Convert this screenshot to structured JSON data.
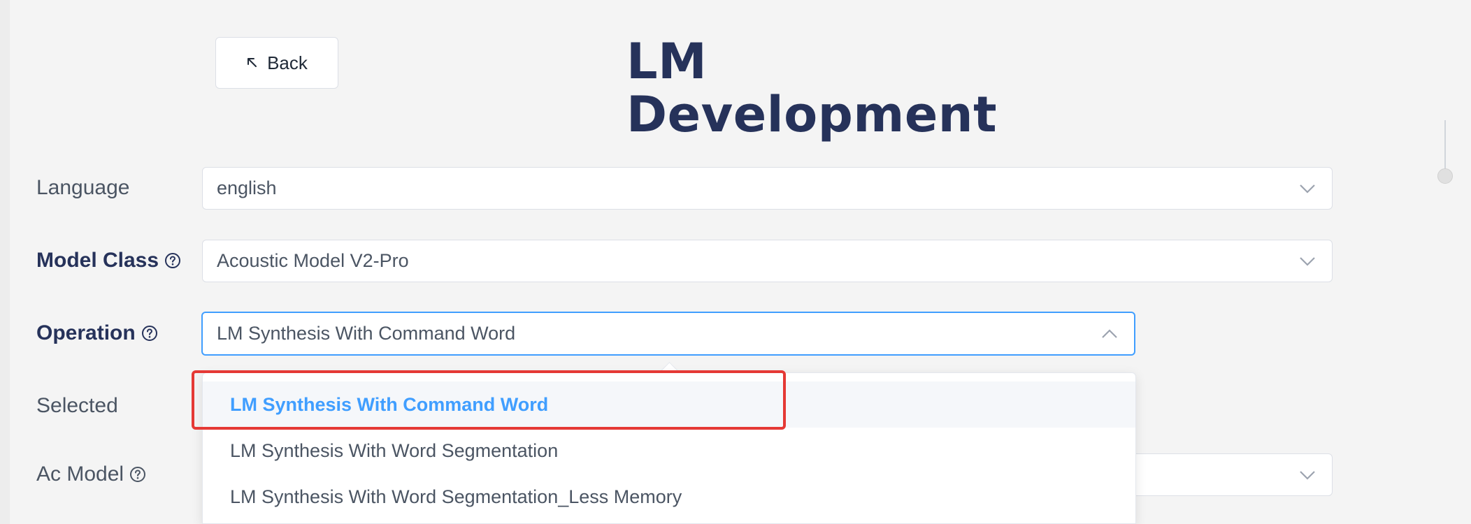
{
  "back_button": {
    "label": "Back"
  },
  "page_title": {
    "line1": "LM",
    "line2": "Development"
  },
  "form": {
    "language": {
      "label": "Language",
      "value": "english"
    },
    "model_class": {
      "label": "Model Class",
      "value": "Acoustic Model V2-Pro"
    },
    "operation": {
      "label": "Operation",
      "value": "LM Synthesis With Command Word",
      "options": [
        "LM Synthesis With Command Word",
        "LM Synthesis With Word Segmentation",
        "LM Synthesis With Word Segmentation_Less Memory"
      ],
      "selected_index": 0
    },
    "selected": {
      "label": "Selected"
    },
    "ac_model": {
      "label": "Ac Model"
    }
  },
  "colors": {
    "title": "#26325a",
    "accent": "#409eff",
    "highlight": "#e53935"
  },
  "icons": {
    "back": "arrow-up-left-icon",
    "help": "question-circle-icon",
    "select_closed": "chevron-down-icon",
    "select_open": "chevron-up-icon"
  }
}
